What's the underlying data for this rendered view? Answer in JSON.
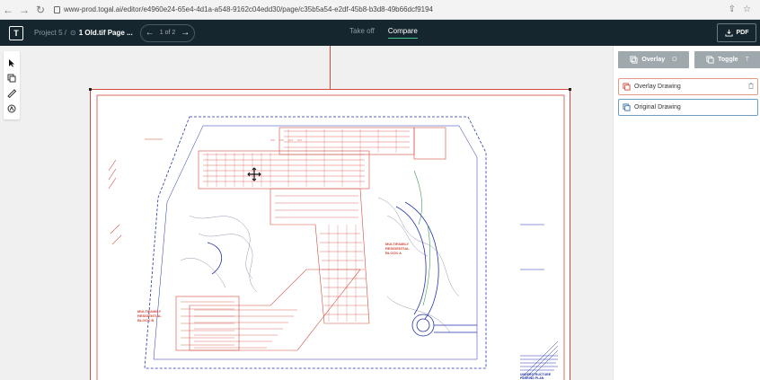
{
  "browser": {
    "url": "www-prod.togal.ai/editor/e4960e24-65e4-4d1a-a548-9162c04edd30/page/c35b5a54-e2df-45b8-b3d8-49b66dcf9194"
  },
  "header": {
    "project": "Project 5 /",
    "file": "1 Old.tif Page ...",
    "page_indicator": "1 of 2",
    "tabs": [
      {
        "label": "Take off",
        "active": false
      },
      {
        "label": "Compare",
        "active": true
      }
    ],
    "pdf_label": "PDF"
  },
  "right_panel": {
    "overlay_label": "Overlay",
    "overlay_key": "O",
    "toggle_label": "Toggle",
    "toggle_key": "T",
    "layers": [
      {
        "label": "Overlay Drawing",
        "color": "#e39b86"
      },
      {
        "label": "Original Drawing",
        "color": "#6b9ec7"
      }
    ]
  },
  "drawing": {
    "labels": [
      "MULTIFAMILY RESIDENTIAL BLOCK B",
      "MULTIFAMILY RESIDENTIAL BLOCK A",
      "UNDERSTRUCTURE PARKING PLAN"
    ]
  },
  "colors": {
    "header_bg": "#16262f",
    "accent": "#3ec98a",
    "overlay_red": "#d24a3c",
    "original_blue": "#2233aa"
  }
}
